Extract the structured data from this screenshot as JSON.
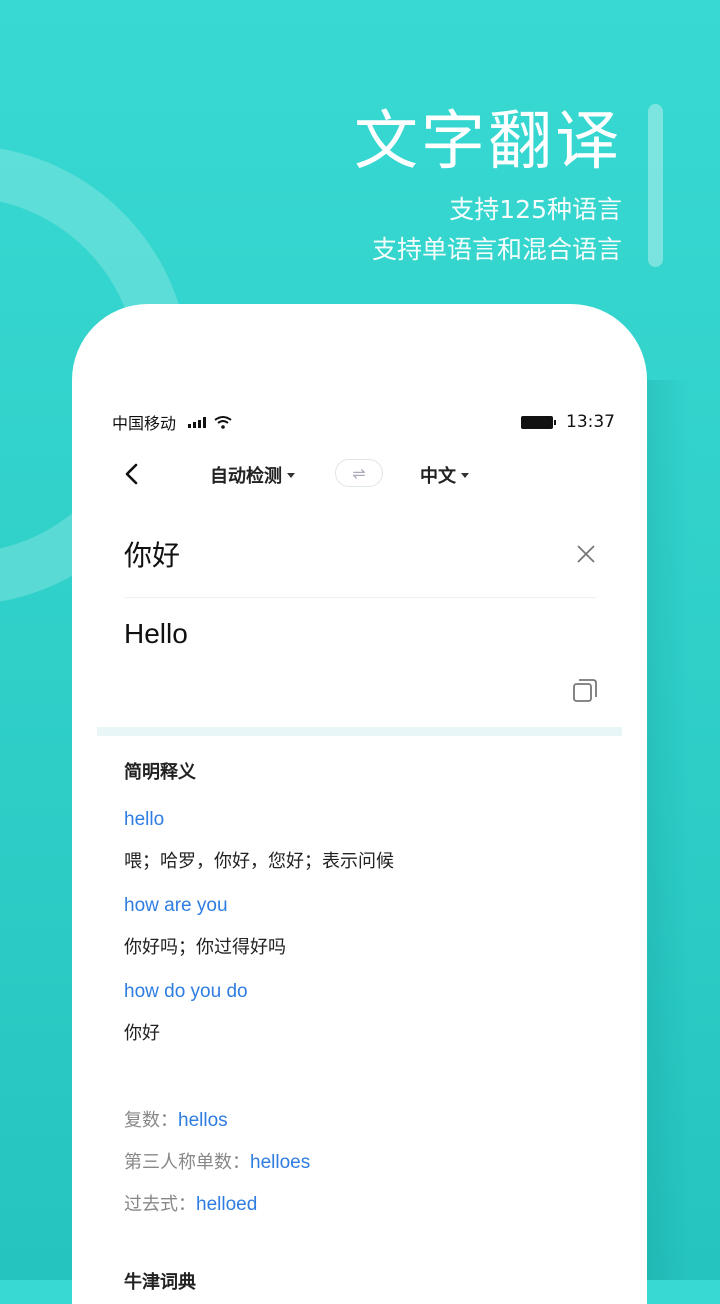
{
  "promo": {
    "title": "文字翻译",
    "subtitle_1": "支持125种语言",
    "subtitle_2": "支持单语言和混合语言"
  },
  "status_bar": {
    "carrier": "中国移动",
    "time": "13:37"
  },
  "nav": {
    "source_lang": "自动检测",
    "target_lang": "中文",
    "swap_glyph": "⇌"
  },
  "translation": {
    "source_text": "你好",
    "target_text": "Hello"
  },
  "definitions": {
    "title": "简明释义",
    "items": [
      {
        "en": "hello",
        "zh": "喂；哈罗，你好，您好；表示问候"
      },
      {
        "en": "how are you",
        "zh": "你好吗；你过得好吗"
      },
      {
        "en": "how do you do",
        "zh": "你好"
      }
    ]
  },
  "word_forms": [
    {
      "label": "复数：",
      "value": "hellos"
    },
    {
      "label": "第三人称单数：",
      "value": "helloes"
    },
    {
      "label": "过去式：",
      "value": "helloed"
    }
  ],
  "next_section": {
    "title": "牛津词典"
  },
  "colors": {
    "background": "#33d3cc",
    "link_blue": "#2f7de1",
    "band": "#e8f6f8"
  }
}
